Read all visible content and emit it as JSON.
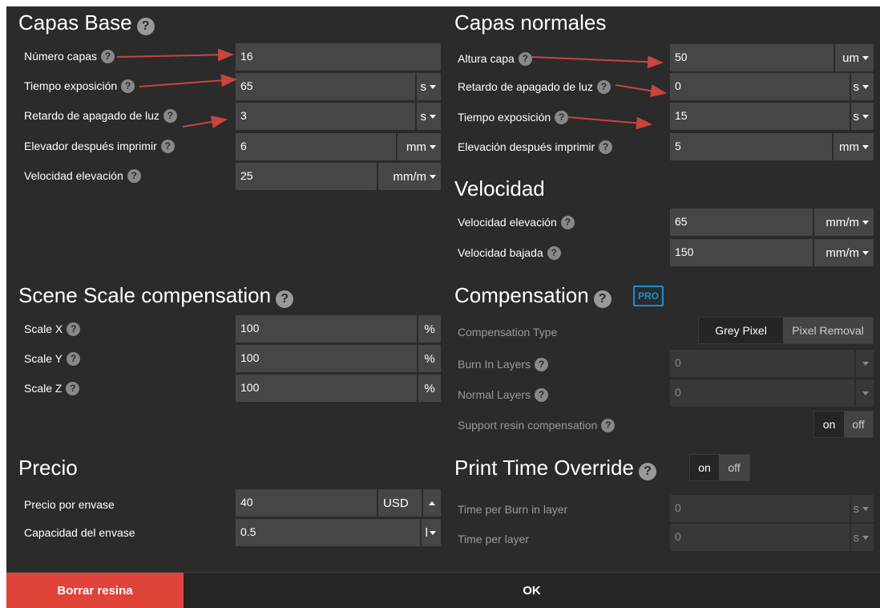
{
  "base": {
    "title": "Capas Base",
    "rows": [
      {
        "label": "Número capas",
        "value": "16",
        "unit": ""
      },
      {
        "label": "Tiempo exposición",
        "value": "65",
        "unit": "s"
      },
      {
        "label": "Retardo de apagado de luz",
        "value": "3",
        "unit": "s"
      },
      {
        "label": "Elevador después imprimir",
        "value": "6",
        "unit": "mm"
      },
      {
        "label": "Velocidad elevación",
        "value": "25",
        "unit": "mm/m"
      }
    ]
  },
  "normal": {
    "title": "Capas normales",
    "rows": [
      {
        "label": "Altura capa",
        "value": "50",
        "unit": "um"
      },
      {
        "label": "Retardo de apagado de luz",
        "value": "0",
        "unit": "s"
      },
      {
        "label": "Tiempo exposición",
        "value": "15",
        "unit": "s"
      },
      {
        "label": "Elevación después imprimir",
        "value": "5",
        "unit": "mm"
      }
    ]
  },
  "speed": {
    "title": "Velocidad",
    "rows": [
      {
        "label": "Velocidad elevación",
        "value": "65",
        "unit": "mm/m"
      },
      {
        "label": "Velocidad bajada",
        "value": "150",
        "unit": "mm/m"
      }
    ]
  },
  "scale": {
    "title": "Scene Scale compensation",
    "rows": [
      {
        "label": "Scale X",
        "value": "100",
        "unit": "%"
      },
      {
        "label": "Scale Y",
        "value": "100",
        "unit": "%"
      },
      {
        "label": "Scale Z",
        "value": "100",
        "unit": "%"
      }
    ]
  },
  "compensation": {
    "title": "Compensation",
    "pro_badge": "PRO",
    "type_label": "Compensation Type",
    "type_options": [
      "Grey Pixel",
      "Pixel Removal"
    ],
    "type_selected": "Grey Pixel",
    "burn_in_label": "Burn In Layers",
    "burn_in_value": "0",
    "normal_label": "Normal Layers",
    "normal_value": "0",
    "support_label": "Support resin compensation",
    "support_on": "on",
    "support_off": "off",
    "support_state": "on"
  },
  "price": {
    "title": "Precio",
    "rows": [
      {
        "label": "Precio por envase",
        "value": "40",
        "unit": "USD"
      },
      {
        "label": "Capacidad del envase",
        "value": "0.5",
        "unit": "l"
      }
    ]
  },
  "override": {
    "title": "Print Time Override",
    "on": "on",
    "off": "off",
    "state": "on",
    "rows": [
      {
        "label": "Time per Burn in layer",
        "value": "0",
        "unit": "s"
      },
      {
        "label": "Time per layer",
        "value": "0",
        "unit": "s"
      }
    ]
  },
  "footer": {
    "delete_label": "Borrar resina",
    "ok_label": "OK"
  },
  "colors": {
    "background": "#2b2b2b",
    "field": "#464646",
    "delete_button": "#e0433a",
    "pro_accent": "#1a8cd8",
    "annotation_arrow": "#c9433f"
  }
}
